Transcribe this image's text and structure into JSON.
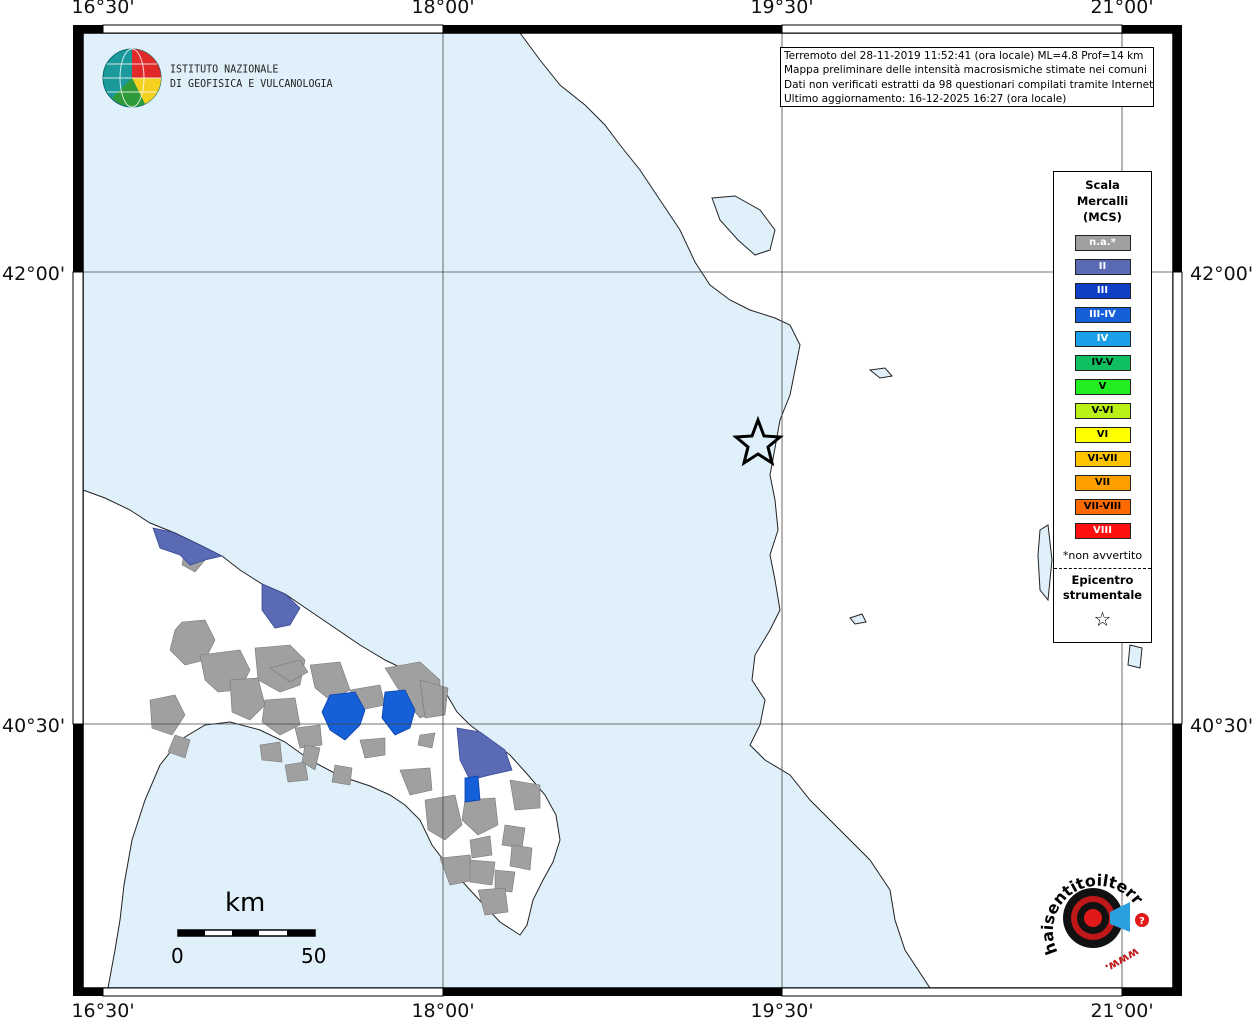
{
  "map": {
    "lon_labels": [
      "16°30'",
      "18°00'",
      "19°30'",
      "21°00'"
    ],
    "lat_labels": [
      "42°00'",
      "40°30'"
    ]
  },
  "info": {
    "line1": "Terremoto del 28-11-2019 11:52:41 (ora locale) ML=4.8 Prof=14 km",
    "line2": "Mappa preliminare delle intensità macrosismiche stimate nei comuni",
    "line3": "Dati non verificati estratti da 98 questionari compilati tramite Internet.",
    "line4": "Ultimo aggiornamento: 16-12-2025 16:27 (ora locale)"
  },
  "legend": {
    "title_line1": "Scala",
    "title_line2": "Mercalli",
    "title_line3": "(MCS)",
    "items": [
      {
        "label": "n.a.*",
        "color": "#a0a0a0",
        "text_color": "#ffffff"
      },
      {
        "label": "II",
        "color": "#5a6ab5",
        "text_color": "#ffffff"
      },
      {
        "label": "III",
        "color": "#0f3fc4",
        "text_color": "#ffffff"
      },
      {
        "label": "III-IV",
        "color": "#1560d8",
        "text_color": "#ffffff"
      },
      {
        "label": "IV",
        "color": "#1aa0e8",
        "text_color": "#ffffff"
      },
      {
        "label": "IV-V",
        "color": "#10c060",
        "text_color": "#000000"
      },
      {
        "label": "V",
        "color": "#22ee22",
        "text_color": "#000000"
      },
      {
        "label": "V-VI",
        "color": "#b8f018",
        "text_color": "#000000"
      },
      {
        "label": "VI",
        "color": "#ffff00",
        "text_color": "#000000"
      },
      {
        "label": "VI-VII",
        "color": "#ffc400",
        "text_color": "#000000"
      },
      {
        "label": "VII",
        "color": "#ffa000",
        "text_color": "#000000"
      },
      {
        "label": "VII-VIII",
        "color": "#ff6a00",
        "text_color": "#000000"
      },
      {
        "label": "VIII",
        "color": "#ff1010",
        "text_color": "#ffffff"
      }
    ],
    "note": "*non avvertito",
    "epicenter_line1": "Epicentro",
    "epicenter_line2": "strumentale"
  },
  "logo": {
    "line1": "ISTITUTO NAZIONALE",
    "line2": "DI GEOFISICA E VULCANOLOGIA"
  },
  "haisentito": {
    "text": "haisentitoilterremoto.it",
    "www": "www."
  },
  "scale_bar": {
    "unit": "km",
    "start": "0",
    "end": "50"
  },
  "colors": {
    "sea": "#e0f0fb",
    "land": "#ffffff",
    "not_felt": "#a0a0a0",
    "intensity_II": "#5a6ab5",
    "intensity_III_IV": "#1560d8"
  }
}
